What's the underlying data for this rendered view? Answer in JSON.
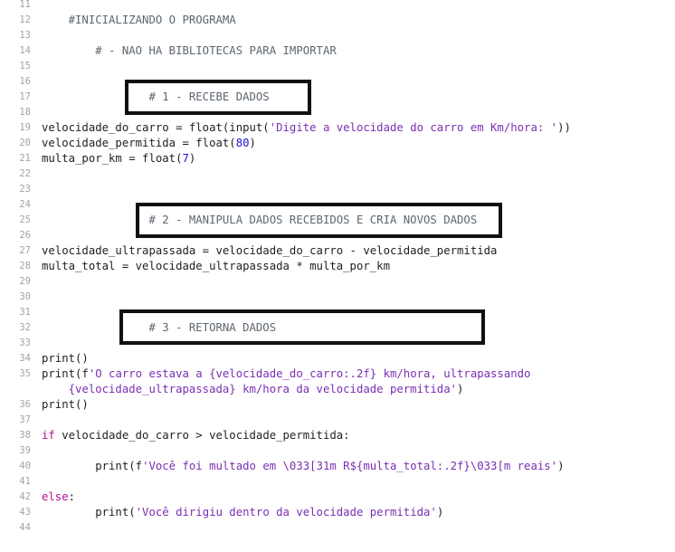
{
  "lines": [
    {
      "ln": "11",
      "code": []
    },
    {
      "ln": "12",
      "code": [
        {
          "t": "    #INICIALIZANDO O PROGRAMA",
          "c": "comment"
        }
      ]
    },
    {
      "ln": "13",
      "code": []
    },
    {
      "ln": "14",
      "code": [
        {
          "t": "        # - NAO HA BIBLIOTECAS PARA IMPORTAR",
          "c": "comment"
        }
      ]
    },
    {
      "ln": "15",
      "code": []
    },
    {
      "ln": "16",
      "code": []
    },
    {
      "ln": "17",
      "code": [
        {
          "t": "                # 1 - RECEBE DADOS",
          "c": "comment"
        }
      ]
    },
    {
      "ln": "18",
      "code": []
    },
    {
      "ln": "19",
      "code": [
        {
          "t": "velocidade_do_carro = float(input(",
          "c": ""
        },
        {
          "t": "'Digite a velocidade do carro em Km/hora: '",
          "c": "str"
        },
        {
          "t": "))",
          "c": ""
        }
      ]
    },
    {
      "ln": "20",
      "code": [
        {
          "t": "velocidade_permitida = float(",
          "c": ""
        },
        {
          "t": "80",
          "c": "num"
        },
        {
          "t": ")",
          "c": ""
        }
      ]
    },
    {
      "ln": "21",
      "code": [
        {
          "t": "multa_por_km = float(",
          "c": ""
        },
        {
          "t": "7",
          "c": "num"
        },
        {
          "t": ")",
          "c": ""
        }
      ]
    },
    {
      "ln": "22",
      "code": []
    },
    {
      "ln": "23",
      "code": []
    },
    {
      "ln": "24",
      "code": []
    },
    {
      "ln": "25",
      "code": [
        {
          "t": "                # 2 - MANIPULA DADOS RECEBIDOS E CRIA NOVOS DADOS",
          "c": "comment"
        }
      ]
    },
    {
      "ln": "26",
      "code": []
    },
    {
      "ln": "27",
      "code": [
        {
          "t": "velocidade_ultrapassada = velocidade_do_carro - velocidade_permitida",
          "c": ""
        }
      ]
    },
    {
      "ln": "28",
      "code": [
        {
          "t": "multa_total = velocidade_ultrapassada * multa_por_km",
          "c": ""
        }
      ]
    },
    {
      "ln": "29",
      "code": []
    },
    {
      "ln": "30",
      "code": []
    },
    {
      "ln": "31",
      "code": []
    },
    {
      "ln": "32",
      "code": [
        {
          "t": "                # 3 - RETORNA DADOS",
          "c": "comment"
        }
      ]
    },
    {
      "ln": "33",
      "code": []
    },
    {
      "ln": "34",
      "code": [
        {
          "t": "print()",
          "c": ""
        }
      ]
    },
    {
      "ln": "35",
      "code": [
        {
          "t": "print(f",
          "c": ""
        },
        {
          "t": "'O carro estava a {velocidade_do_carro:.2f} km/hora, ultrapassando",
          "c": "str"
        }
      ]
    },
    {
      "ln": "",
      "code": [
        {
          "t": "    {velocidade_ultrapassada} km/hora da velocidade permitida'",
          "c": "str"
        },
        {
          "t": ")",
          "c": ""
        }
      ]
    },
    {
      "ln": "36",
      "code": [
        {
          "t": "print()",
          "c": ""
        }
      ]
    },
    {
      "ln": "37",
      "code": []
    },
    {
      "ln": "38",
      "code": [
        {
          "t": "if",
          "c": "kw"
        },
        {
          "t": " velocidade_do_carro > velocidade_permitida:",
          "c": ""
        }
      ]
    },
    {
      "ln": "39",
      "code": []
    },
    {
      "ln": "40",
      "code": [
        {
          "t": "        print(f",
          "c": ""
        },
        {
          "t": "'Você foi multado em \\033[31m R${multa_total:.2f}\\033[m reais'",
          "c": "str"
        },
        {
          "t": ")",
          "c": ""
        }
      ]
    },
    {
      "ln": "41",
      "code": []
    },
    {
      "ln": "42",
      "code": [
        {
          "t": "else",
          "c": "kw"
        },
        {
          "t": ":",
          "c": ""
        }
      ]
    },
    {
      "ln": "43",
      "code": [
        {
          "t": "        print(",
          "c": ""
        },
        {
          "t": "'Você dirigiu dentro da velocidade permitida'",
          "c": "str"
        },
        {
          "t": ")",
          "c": ""
        }
      ]
    },
    {
      "ln": "44",
      "code": []
    }
  ]
}
